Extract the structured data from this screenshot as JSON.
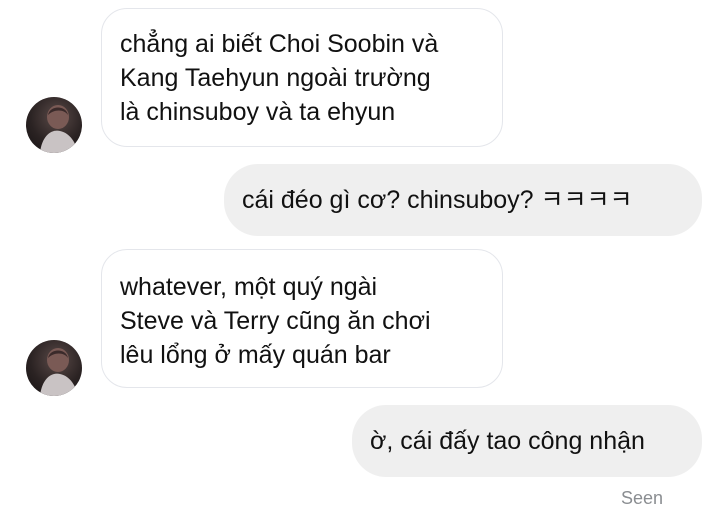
{
  "messages": [
    {
      "direction": "incoming",
      "lines": [
        "chẳng ai biết Choi Soobin và",
        "Kang Taehyun ngoài trường",
        "là chinsuboy và ta ehyun"
      ]
    },
    {
      "direction": "outgoing",
      "lines": [
        "cái đéo gì cơ? chinsuboy? ㅋㅋㅋㅋ"
      ]
    },
    {
      "direction": "incoming",
      "lines": [
        "whatever, một quý ngài",
        "Steve và Terry cũng ăn chơi",
        "lêu lổng ở mấy quán bar"
      ]
    },
    {
      "direction": "outgoing",
      "lines": [
        "ờ, cái đấy tao công nhận"
      ]
    }
  ],
  "status": {
    "seen_label": "Seen"
  },
  "colors": {
    "incoming_bubble": "#ffffff",
    "incoming_border": "#e4e6eb",
    "outgoing_bubble": "#efefef",
    "status_text": "#8a8d91"
  }
}
